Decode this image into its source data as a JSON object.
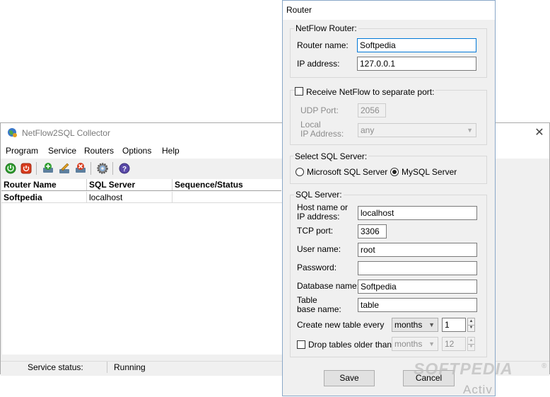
{
  "main_window": {
    "title": "NetFlow2SQL Collector",
    "close_symbol": "✕",
    "menu": [
      "Program",
      "Service",
      "Routers",
      "Options",
      "Help"
    ],
    "toolbar_icons": [
      "start-service-icon",
      "stop-service-icon",
      "add-router-icon",
      "edit-router-icon",
      "delete-router-icon",
      "settings-icon",
      "help-icon"
    ],
    "columns": [
      "Router Name",
      "SQL Server",
      "Sequence/Status"
    ],
    "rows": [
      {
        "router_name": "Softpedia",
        "sql_server": "localhost",
        "status": ""
      }
    ],
    "status_label": "Service status:",
    "status_value": "Running"
  },
  "dialog": {
    "title": "Router",
    "netflow_group": {
      "title": "NetFlow Router:",
      "router_name_label": "Router name:",
      "router_name_value": "Softpedia",
      "ip_label": "IP address:",
      "ip_value": "127.0.0.1"
    },
    "separate_port": {
      "checkbox_label": "Receive NetFlow to separate port:",
      "checked": false,
      "udp_label": "UDP Port:",
      "udp_value": "2056",
      "local_ip_label_1": "Local",
      "local_ip_label_2": "IP Address:",
      "local_ip_value": "any"
    },
    "sql_select": {
      "title": "Select SQL Server:",
      "option_mssql": "Microsoft SQL Server",
      "option_mysql": "MySQL Server",
      "selected": "MySQL Server"
    },
    "sql_server": {
      "title": "SQL Server:",
      "host_label_1": "Host name or",
      "host_label_2": "IP address:",
      "host_value": "localhost",
      "port_label": "TCP port:",
      "port_value": "3306",
      "user_label": "User name:",
      "user_value": "root",
      "password_label": "Password:",
      "password_value": "",
      "database_label": "Database name:",
      "database_value": "Softpedia",
      "table_label_1": "Table",
      "table_label_2": "base name:",
      "table_value": "table",
      "create_table_label": "Create new table every",
      "create_period": "months",
      "create_count": "1",
      "drop_tables_label": "Drop tables older than",
      "drop_checked": false,
      "drop_period": "months",
      "drop_count": "12"
    },
    "save_label": "Save",
    "cancel_label": "Cancel"
  },
  "watermark": {
    "brand": "SOFTPEDIA",
    "trademark": "®",
    "activation_fragment": "Activ"
  },
  "colors": {
    "accent_focus": "#0078d7",
    "start_green": "#2f9e2f",
    "stop_red": "#d83b1d",
    "help_purple": "#5a4aa8"
  }
}
